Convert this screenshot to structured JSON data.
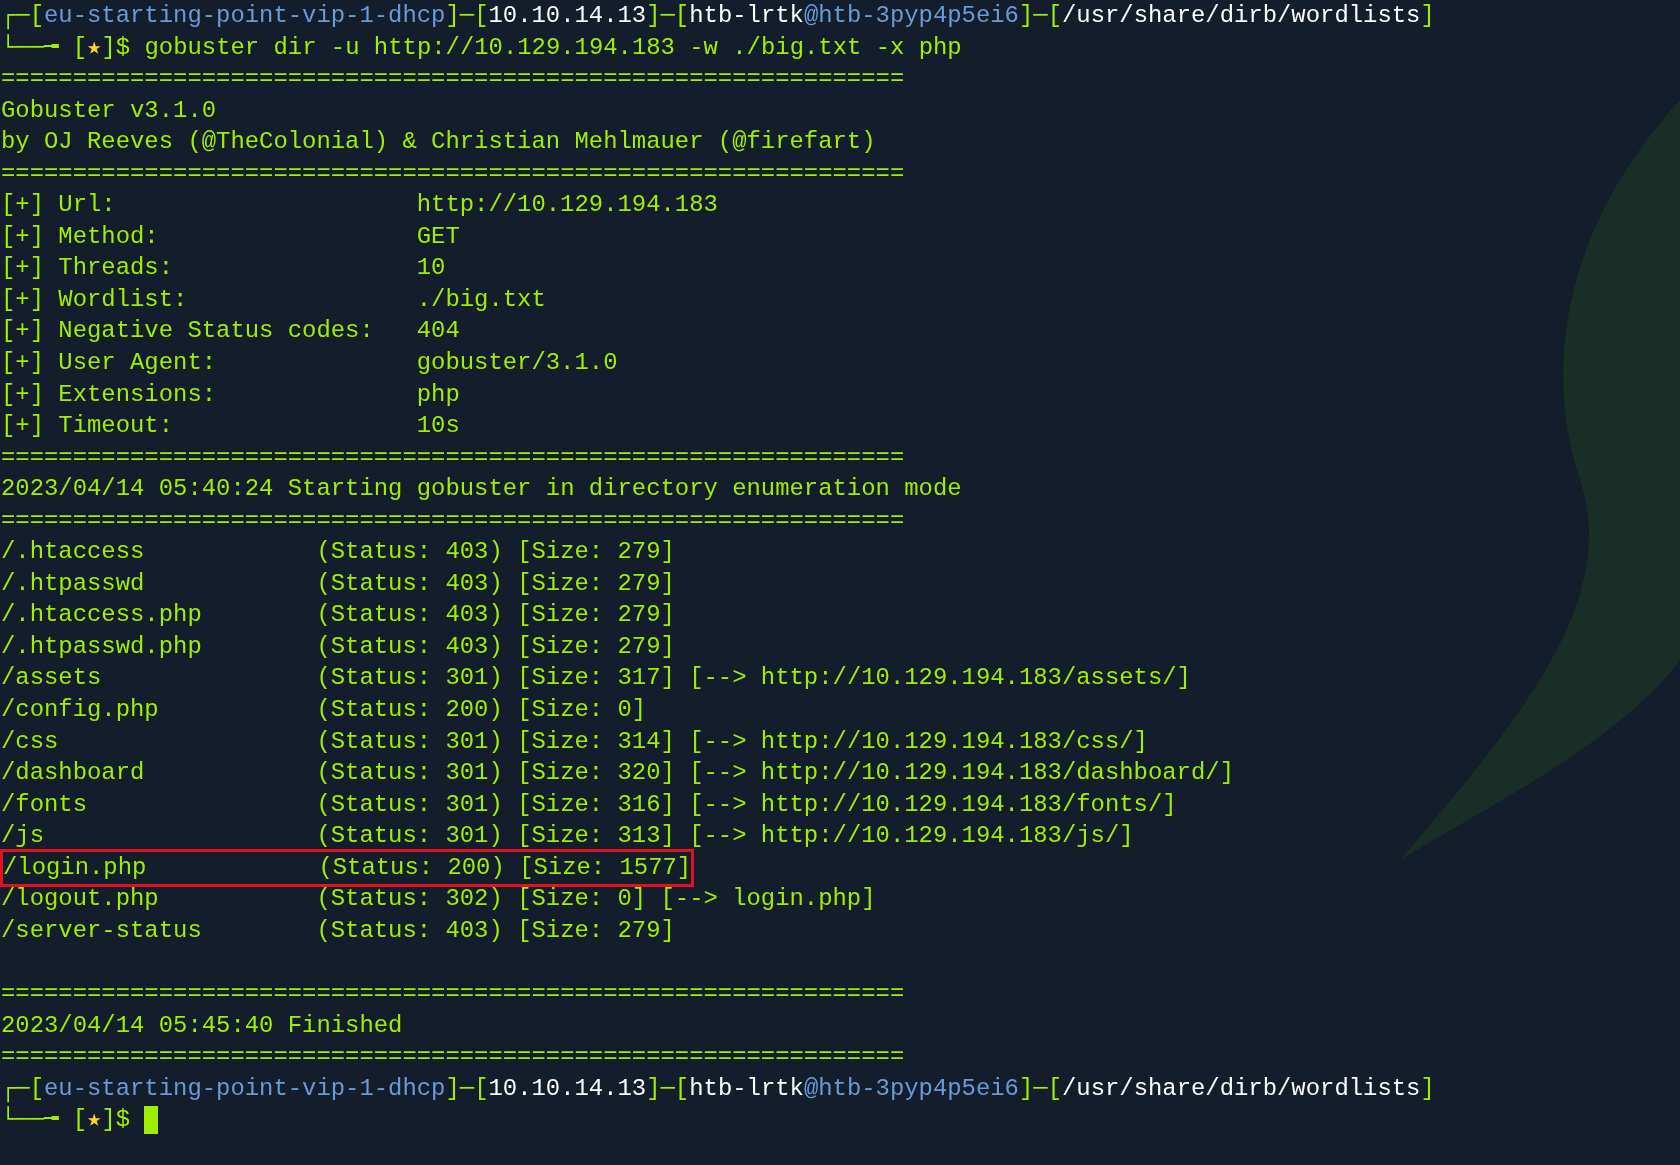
{
  "lines": [
    {
      "kind": "prompt",
      "segments": [
        {
          "text": "┌─[",
          "color": "#9fef00"
        },
        {
          "text": "eu-starting-point-vip-1-dhcp",
          "color": "#6a9ad8"
        },
        {
          "text": "]─[",
          "color": "#9fef00"
        },
        {
          "text": "10.10.14.13",
          "color": "#ffffff"
        },
        {
          "text": "]─[",
          "color": "#9fef00"
        },
        {
          "text": "htb-lrtk",
          "color": "#ffffff"
        },
        {
          "text": "@htb-3pyp4p5ei6",
          "color": "#6a9ad8"
        },
        {
          "text": "]─[",
          "color": "#9fef00"
        },
        {
          "text": "/usr/share/dirb/wordlists",
          "color": "#ffffff"
        },
        {
          "text": "]",
          "color": "#9fef00"
        }
      ]
    },
    {
      "kind": "command",
      "segments": [
        {
          "text": "└──╼ [",
          "color": "#9fef00"
        },
        {
          "text": "★",
          "color": "#ffcc33"
        },
        {
          "text": "]$ gobuster dir -u http://10.129.194.183 -w ./big.txt -x php",
          "color": "#9fef00"
        }
      ],
      "cursor": false
    },
    {
      "kind": "rule",
      "text": "==============================================================="
    },
    {
      "kind": "text",
      "text": "Gobuster v3.1.0"
    },
    {
      "kind": "text",
      "text": "by OJ Reeves (@TheColonial) & Christian Mehlmauer (@firefart)"
    },
    {
      "kind": "rule",
      "text": "==============================================================="
    },
    {
      "kind": "param",
      "label": "[+] Url:",
      "value": "http://10.129.194.183"
    },
    {
      "kind": "param",
      "label": "[+] Method:",
      "value": "GET"
    },
    {
      "kind": "param",
      "label": "[+] Threads:",
      "value": "10"
    },
    {
      "kind": "param",
      "label": "[+] Wordlist:",
      "value": "./big.txt"
    },
    {
      "kind": "param",
      "label": "[+] Negative Status codes:",
      "value": "404"
    },
    {
      "kind": "param",
      "label": "[+] User Agent:",
      "value": "gobuster/3.1.0"
    },
    {
      "kind": "param",
      "label": "[+] Extensions:",
      "value": "php"
    },
    {
      "kind": "param",
      "label": "[+] Timeout:",
      "value": "10s"
    },
    {
      "kind": "rule",
      "text": "==============================================================="
    },
    {
      "kind": "text",
      "text": "2023/04/14 05:40:24 Starting gobuster in directory enumeration mode"
    },
    {
      "kind": "rule",
      "text": "==============================================================="
    },
    {
      "kind": "result",
      "path": "/.htaccess",
      "status": "(Status: 403)",
      "size": "[Size: 279]",
      "highlighted": false
    },
    {
      "kind": "result",
      "path": "/.htpasswd",
      "status": "(Status: 403)",
      "size": "[Size: 279]",
      "highlighted": false
    },
    {
      "kind": "result",
      "path": "/.htaccess.php",
      "status": "(Status: 403)",
      "size": "[Size: 279]",
      "highlighted": false
    },
    {
      "kind": "result",
      "path": "/.htpasswd.php",
      "status": "(Status: 403)",
      "size": "[Size: 279]",
      "highlighted": false
    },
    {
      "kind": "result",
      "path": "/assets",
      "status": "(Status: 301)",
      "size": "[Size: 317]",
      "redirect": "[--> http://10.129.194.183/assets/]",
      "highlighted": false
    },
    {
      "kind": "result",
      "path": "/config.php",
      "status": "(Status: 200)",
      "size": "[Size: 0]",
      "highlighted": false
    },
    {
      "kind": "result",
      "path": "/css",
      "status": "(Status: 301)",
      "size": "[Size: 314]",
      "redirect": "[--> http://10.129.194.183/css/]",
      "highlighted": false
    },
    {
      "kind": "result",
      "path": "/dashboard",
      "status": "(Status: 301)",
      "size": "[Size: 320]",
      "redirect": "[--> http://10.129.194.183/dashboard/]",
      "highlighted": false
    },
    {
      "kind": "result",
      "path": "/fonts",
      "status": "(Status: 301)",
      "size": "[Size: 316]",
      "redirect": "[--> http://10.129.194.183/fonts/]",
      "highlighted": false
    },
    {
      "kind": "result",
      "path": "/js",
      "status": "(Status: 301)",
      "size": "[Size: 313]",
      "redirect": "[--> http://10.129.194.183/js/]",
      "highlighted": false
    },
    {
      "kind": "result",
      "path": "/login.php",
      "status": "(Status: 200)",
      "size": "[Size: 1577]",
      "highlighted": true
    },
    {
      "kind": "result",
      "path": "/logout.php",
      "status": "(Status: 302)",
      "size": "[Size: 0]",
      "redirect": "[--> login.php]",
      "highlighted": false
    },
    {
      "kind": "result",
      "path": "/server-status",
      "status": "(Status: 403)",
      "size": "[Size: 279]",
      "highlighted": false
    },
    {
      "kind": "blank"
    },
    {
      "kind": "rule",
      "text": "==============================================================="
    },
    {
      "kind": "text",
      "text": "2023/04/14 05:45:40 Finished"
    },
    {
      "kind": "rule",
      "text": "==============================================================="
    },
    {
      "kind": "prompt",
      "segments": [
        {
          "text": "┌─[",
          "color": "#9fef00"
        },
        {
          "text": "eu-starting-point-vip-1-dhcp",
          "color": "#6a9ad8"
        },
        {
          "text": "]─[",
          "color": "#9fef00"
        },
        {
          "text": "10.10.14.13",
          "color": "#ffffff"
        },
        {
          "text": "]─[",
          "color": "#9fef00"
        },
        {
          "text": "htb-lrtk",
          "color": "#ffffff"
        },
        {
          "text": "@htb-3pyp4p5ei6",
          "color": "#6a9ad8"
        },
        {
          "text": "]─[",
          "color": "#9fef00"
        },
        {
          "text": "/usr/share/dirb/wordlists",
          "color": "#ffffff"
        },
        {
          "text": "]",
          "color": "#9fef00"
        }
      ]
    },
    {
      "kind": "command",
      "segments": [
        {
          "text": "└──╼ [",
          "color": "#9fef00"
        },
        {
          "text": "★",
          "color": "#ffcc33"
        },
        {
          "text": "]$ ",
          "color": "#9fef00"
        }
      ],
      "cursor": true
    }
  ]
}
